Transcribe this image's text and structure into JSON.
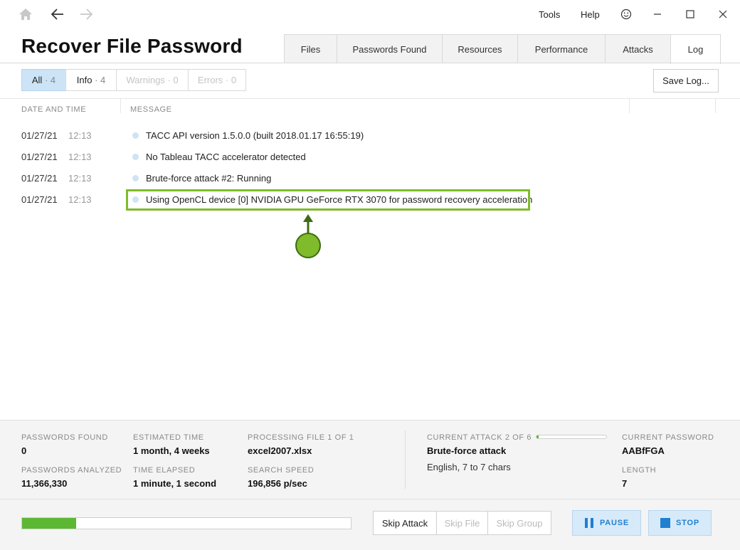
{
  "window": {
    "menu": {
      "tools": "Tools",
      "help": "Help"
    },
    "icons": [
      "home-icon",
      "back-arrow-icon",
      "forward-arrow-icon",
      "smiley-icon",
      "minimize-icon",
      "maximize-icon",
      "close-icon"
    ]
  },
  "app": {
    "title": "Recover File Password"
  },
  "tabs": [
    {
      "label": "Files"
    },
    {
      "label": "Passwords Found"
    },
    {
      "label": "Resources"
    },
    {
      "label": "Performance"
    },
    {
      "label": "Attacks"
    },
    {
      "label": "Log",
      "active": true
    }
  ],
  "filters": [
    {
      "label": "All",
      "count": "· 4",
      "active": true
    },
    {
      "label": "Info",
      "count": "· 4"
    },
    {
      "label": "Warnings",
      "count": "· 0",
      "disabled": true
    },
    {
      "label": "Errors",
      "count": "· 0",
      "disabled": true
    }
  ],
  "save_log": "Save Log...",
  "log": {
    "headers": {
      "date": "DATE AND TIME",
      "message": "MESSAGE"
    },
    "rows": [
      {
        "date": "01/27/21",
        "time": "12:13",
        "message": "TACC API version 1.5.0.0 (built 2018.01.17 16:55:19)"
      },
      {
        "date": "01/27/21",
        "time": "12:13",
        "message": "No Tableau TACC accelerator detected"
      },
      {
        "date": "01/27/21",
        "time": "12:13",
        "message": "Brute-force attack #2: Running"
      },
      {
        "date": "01/27/21",
        "time": "12:13",
        "message": "Using OpenCL device [0] NVIDIA GPU GeForce RTX 3070 for password recovery acceleration"
      }
    ]
  },
  "status": {
    "passwords_found": {
      "label": "PASSWORDS FOUND",
      "value": "0"
    },
    "passwords_analyzed": {
      "label": "PASSWORDS ANALYZED",
      "value": "11,366,330"
    },
    "estimated_time": {
      "label": "ESTIMATED TIME",
      "value": "1 month, 4 weeks"
    },
    "time_elapsed": {
      "label": "TIME ELAPSED",
      "value": "1 minute, 1 second"
    },
    "processing_file": {
      "label": "PROCESSING FILE 1 OF 1",
      "value": "excel2007.xlsx"
    },
    "search_speed": {
      "label": "SEARCH SPEED",
      "value": "196,856 p/sec"
    },
    "current_attack": {
      "label": "CURRENT ATTACK 2 OF 6",
      "value": "Brute-force attack",
      "detail": "English, 7 to 7 chars",
      "progress": 0.03
    },
    "current_password": {
      "label": "CURRENT PASSWORD",
      "value": "AABfFGA"
    },
    "length": {
      "label": "LENGTH",
      "value": "7"
    }
  },
  "overall_progress": 0.165,
  "actions": {
    "skip_attack": "Skip Attack",
    "skip_file": "Skip File",
    "skip_group": "Skip Group",
    "pause": "PAUSE",
    "stop": "STOP"
  },
  "colors": {
    "accent": "#1f7fd1",
    "progress": "#5cb833",
    "highlight": "#7fbb2a"
  }
}
